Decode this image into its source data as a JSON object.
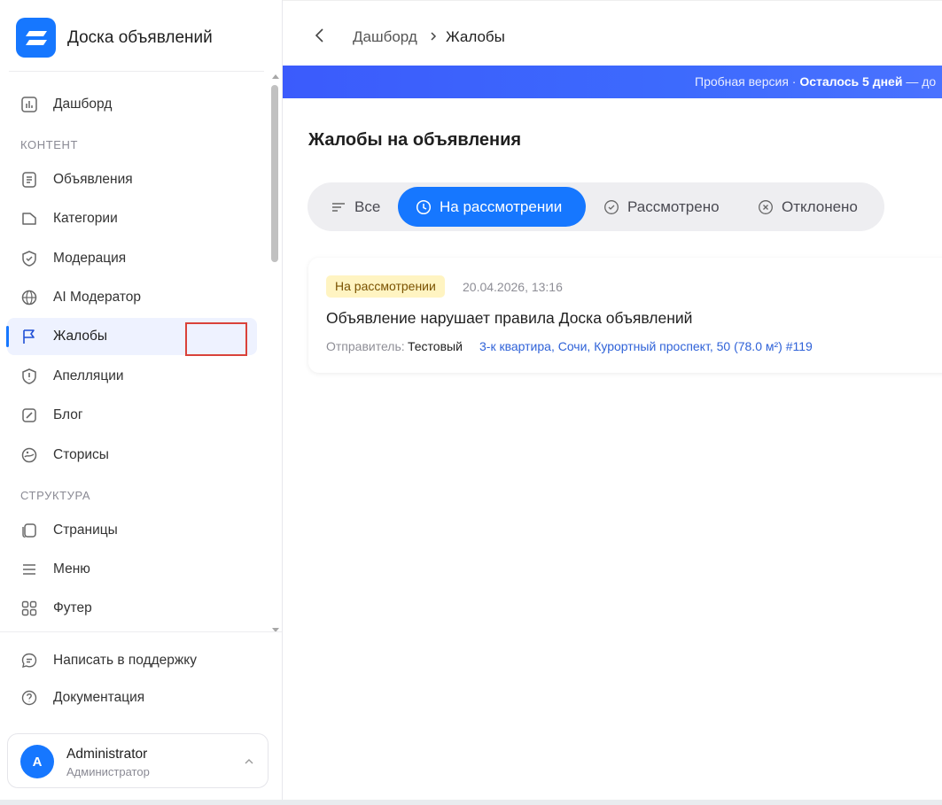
{
  "brand": {
    "title": "Доска объявлений"
  },
  "sidebar": {
    "items": [
      {
        "label": "Дашборд"
      },
      {
        "section": "КОНТЕНТ"
      },
      {
        "label": "Объявления"
      },
      {
        "label": "Категории"
      },
      {
        "label": "Модерация"
      },
      {
        "label": "AI Модератор"
      },
      {
        "label": "Жалобы",
        "active": true
      },
      {
        "label": "Апелляции"
      },
      {
        "label": "Блог"
      },
      {
        "label": "Сторисы"
      },
      {
        "section": "СТРУКТУРА"
      },
      {
        "label": "Страницы"
      },
      {
        "label": "Меню"
      },
      {
        "label": "Футер"
      }
    ],
    "footer": [
      {
        "label": "Написать в поддержку"
      },
      {
        "label": "Документация"
      }
    ],
    "user": {
      "initial": "A",
      "name": "Administrator",
      "role": "Администратор"
    }
  },
  "header": {
    "breadcrumb": {
      "parent": "Дашборд",
      "current": "Жалобы"
    }
  },
  "trial": {
    "prefix": "Пробная версия · ",
    "bold": "Осталось 5 дней",
    "suffix": " — до"
  },
  "page": {
    "title": "Жалобы на объявления"
  },
  "tabs": [
    {
      "label": "Все"
    },
    {
      "label": "На рассмотрении",
      "active": true
    },
    {
      "label": "Рассмотрено"
    },
    {
      "label": "Отклонено"
    }
  ],
  "complaints": [
    {
      "status": "На рассмотрении",
      "date": "20.04.2026, 13:16",
      "title": "Объявление нарушает правила Доска объявлений",
      "sender_label": "Отправитель:",
      "sender": "Тестовый",
      "ad_link": "3-к квартира, Сочи, Курортный проспект, 50 (78.0 м²) #119"
    }
  ],
  "colors": {
    "accent": "#1677ff",
    "badge_bg": "#fff4c2",
    "badge_text": "#7a5200",
    "link": "#2f62d8"
  }
}
